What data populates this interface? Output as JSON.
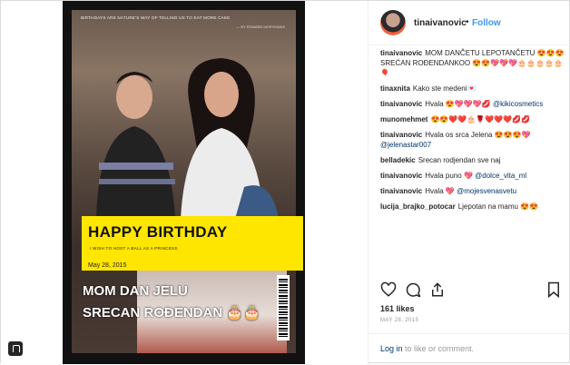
{
  "post": {
    "username": "tinaivanovic",
    "follow_label": "Follow",
    "dot": "•",
    "likes": "161 likes",
    "date": "MAY 28, 2015",
    "login_link": "Log in",
    "login_text": " to like or comment."
  },
  "photo": {
    "quote": "BIRTHDAYS ARE NATURE'S WAY OF TELLING US TO EAT MORE CAKE",
    "quote_author": "— BY EDWARD MORYKWAS",
    "banner_title": "HAPPY BIRTHDAY",
    "banner_sub": "I WISH TO HOST A BALL AS A PRINCESS",
    "banner_date": "May 28, 2015",
    "overlay_line1": "MOM DAN JELU",
    "overlay_line2": "SRECAN ROĐENDAN 🎂🎂"
  },
  "comments": [
    {
      "user": "tinaivanovic",
      "text": "MOM DANČETU LEPOTANČETU 😍😍😍 SREĆAN ROĐENDANKOO 😍😍💖💖💖🎂🎂🎂🎂🎂🎈",
      "mention": ""
    },
    {
      "user": "tinaxnita",
      "text": "Kako ste medeni💌",
      "mention": ""
    },
    {
      "user": "tinaivanovic",
      "text": "Hvala 😍💖💖💖💋 ",
      "mention": "@kikicosmetics"
    },
    {
      "user": "munomehmet",
      "text": "😍😍❤️❤️🎂🌹❤️❤️❤️💋💋",
      "mention": ""
    },
    {
      "user": "tinaivanovic",
      "text": "Hvala os srca Jelena 😍😍😍💖 ",
      "mention": "@jelenastar007"
    },
    {
      "user": "belladekic",
      "text": "Srecan rodjendan sve naj",
      "mention": ""
    },
    {
      "user": "tinaivanovic",
      "text": "Hvala puno 💖 ",
      "mention": "@dolce_vita_ml"
    },
    {
      "user": "tinaivanovic",
      "text": "Hvala 💖 ",
      "mention": "@mojesvenasvetu"
    },
    {
      "user": "lucija_brajko_potocar",
      "text": "Ljepotan na mamu 😍😍",
      "mention": ""
    }
  ],
  "icons": [
    "heart-icon",
    "comment-icon",
    "share-icon",
    "bookmark-icon",
    "save-collection-icon"
  ]
}
